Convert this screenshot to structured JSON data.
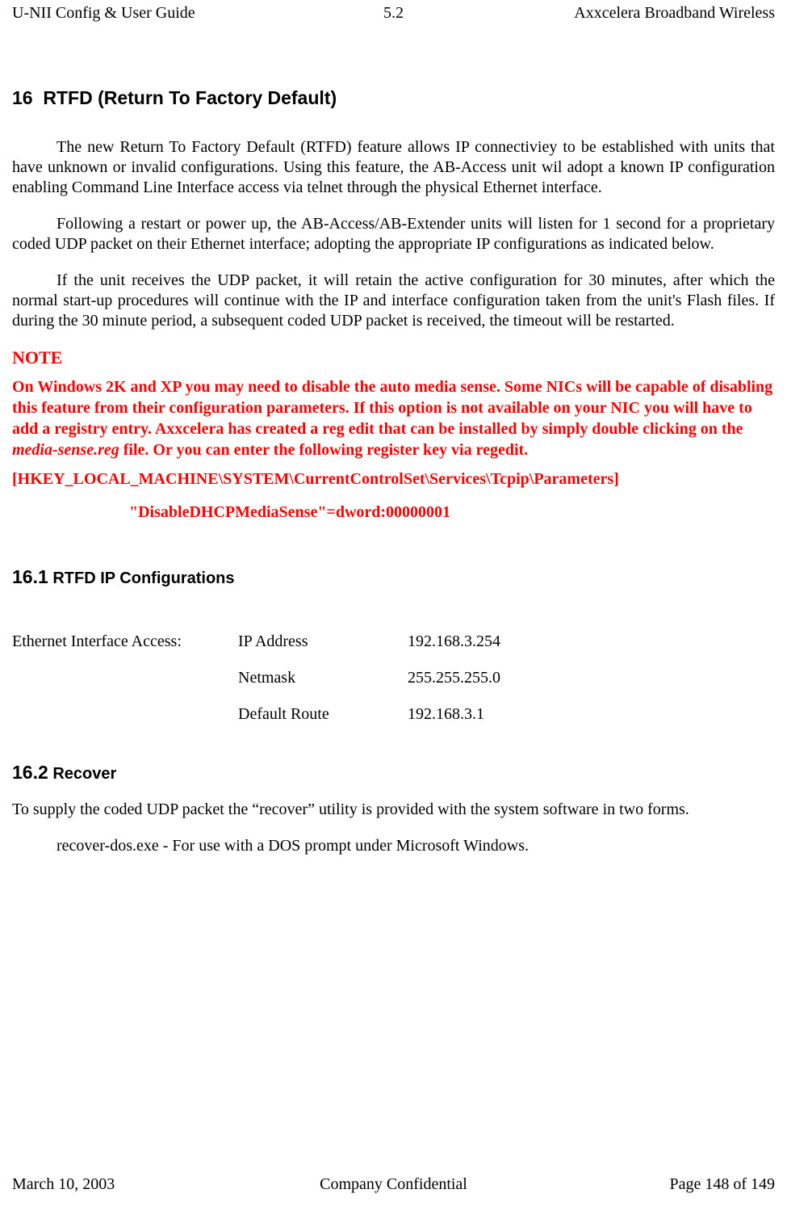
{
  "header": {
    "left": "U-NII Config & User Guide",
    "mid": "5.2",
    "right": "Axxcelera Broadband Wireless"
  },
  "section16": {
    "num": "16",
    "title": "RTFD (Return To Factory Default)",
    "p1": "The new Return To Factory Default (RTFD) feature allows IP connectiviey to be established with units that have unknown or invalid configurations. Using this feature, the AB-Access unit wil adopt a known IP configuration enabling Command Line Interface access via telnet through the physical Ethernet interface.",
    "p2": "Following a restart or power up, the AB-Access/AB-Extender units will listen for 1 second for a proprietary coded UDP packet on their Ethernet interface; adopting the appropriate IP configurations as indicated below.",
    "p3": "If the unit receives the UDP packet, it will retain the active configuration for 30 minutes, after which the normal start-up procedures will continue with the IP and interface configuration taken from the unit's Flash files. If during the 30 minute period, a subsequent coded UDP packet is received, the timeout will be restarted."
  },
  "note": {
    "heading": "NOTE",
    "body_pre": "On Windows 2K and XP you may need to disable the auto media sense. Some NICs will be capable of disabling this feature from their configuration parameters. If this option is not available on your NIC you will have to add a registry entry. Axxcelera has created a reg edit that can be installed by simply double clicking on the ",
    "body_ital": "media-sense.reg",
    "body_post": " file. Or you can enter the following register key via regedit.",
    "regkey": "[HKEY_LOCAL_MACHINE\\SYSTEM\\CurrentControlSet\\Services\\Tcpip\\Parameters]",
    "regval": "\"DisableDHCPMediaSense\"=dword:00000001"
  },
  "section16_1": {
    "num": "16.1",
    "title": "RTFD IP Configurations",
    "label": "Ethernet Interface Access:",
    "rows": [
      {
        "field": "IP Address",
        "value": "192.168.3.254"
      },
      {
        "field": "Netmask",
        "value": "255.255.255.0"
      },
      {
        "field": "Default Route",
        "value": "192.168.3.1"
      }
    ]
  },
  "section16_2": {
    "num": "16.2",
    "title": "Recover",
    "p1": "To supply the coded UDP packet the “recover” utility is provided with the system software in two forms.",
    "item1": "recover-dos.exe  -  For use with a DOS prompt under Microsoft Windows."
  },
  "footer": {
    "left": "March 10, 2003",
    "mid": "Company Confidential",
    "right": "Page 148 of 149"
  }
}
